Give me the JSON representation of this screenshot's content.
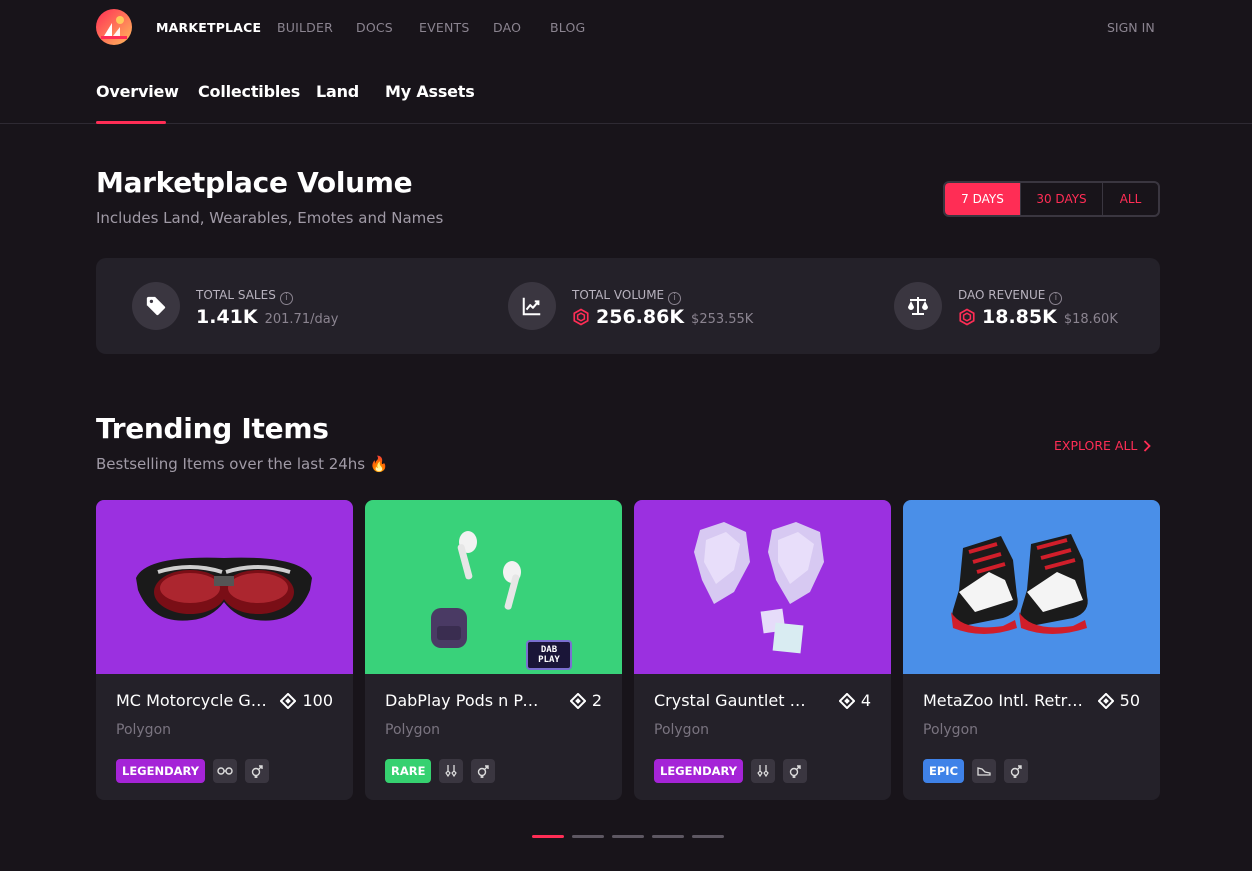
{
  "colors": {
    "accent": "#ff2d55",
    "background": "#18141a",
    "panel": "#242129",
    "legendary": "#a524d7",
    "rare": "#36d170",
    "epic": "#3f82e8"
  },
  "topnav": {
    "items": [
      {
        "label": "MARKETPLACE",
        "active": true
      },
      {
        "label": "BUILDER"
      },
      {
        "label": "DOCS"
      },
      {
        "label": "EVENTS"
      },
      {
        "label": "DAO"
      },
      {
        "label": "BLOG"
      }
    ],
    "sign_in": "SIGN IN"
  },
  "subnav": {
    "tabs": [
      {
        "label": "Overview",
        "active": true
      },
      {
        "label": "Collectibles"
      },
      {
        "label": "Land"
      },
      {
        "label": "My Assets"
      }
    ]
  },
  "volume": {
    "title": "Marketplace Volume",
    "subtitle": "Includes Land, Wearables, Emotes and Names",
    "ranges": [
      "7 DAYS",
      "30 DAYS",
      "ALL"
    ],
    "active_range": "7 DAYS",
    "stats": [
      {
        "label": "TOTAL SALES",
        "icon": "price-tag-icon",
        "value": "1.41K",
        "sub": "201.71/day"
      },
      {
        "label": "TOTAL VOLUME",
        "icon": "trend-chart-icon",
        "value": "256.86K",
        "sub": "$253.55K"
      },
      {
        "label": "DAO REVENUE",
        "icon": "balance-scale-icon",
        "value": "18.85K",
        "sub": "$18.60K"
      }
    ]
  },
  "trending": {
    "title": "Trending Items",
    "subtitle": "Bestselling Items over the last 24hs 🔥",
    "explore_label": "EXPLORE ALL",
    "items": [
      {
        "name": "MC Motorcycle Goggles",
        "price": "100",
        "network": "Polygon",
        "rarity": "LEGENDARY",
        "category_icon": "eyewear-icon",
        "bg": "#9b30e0"
      },
      {
        "name": "DabPlay Pods n Pack",
        "price": "2",
        "network": "Polygon",
        "rarity": "RARE",
        "category_icon": "earring-icon",
        "bg": "#39d27a",
        "thumb_text": "DAB PLAY"
      },
      {
        "name": "Crystal Gauntlet with Cubes",
        "price": "4",
        "network": "Polygon",
        "rarity": "LEGENDARY",
        "category_icon": "earring-icon",
        "bg": "#9b30e0"
      },
      {
        "name": "MetaZoo Intl. Retro Sneakers",
        "price": "50",
        "network": "Polygon",
        "rarity": "EPIC",
        "category_icon": "sneaker-icon",
        "bg": "#4a8fe8"
      }
    ],
    "pagination_count": 5,
    "active_page": 1
  }
}
